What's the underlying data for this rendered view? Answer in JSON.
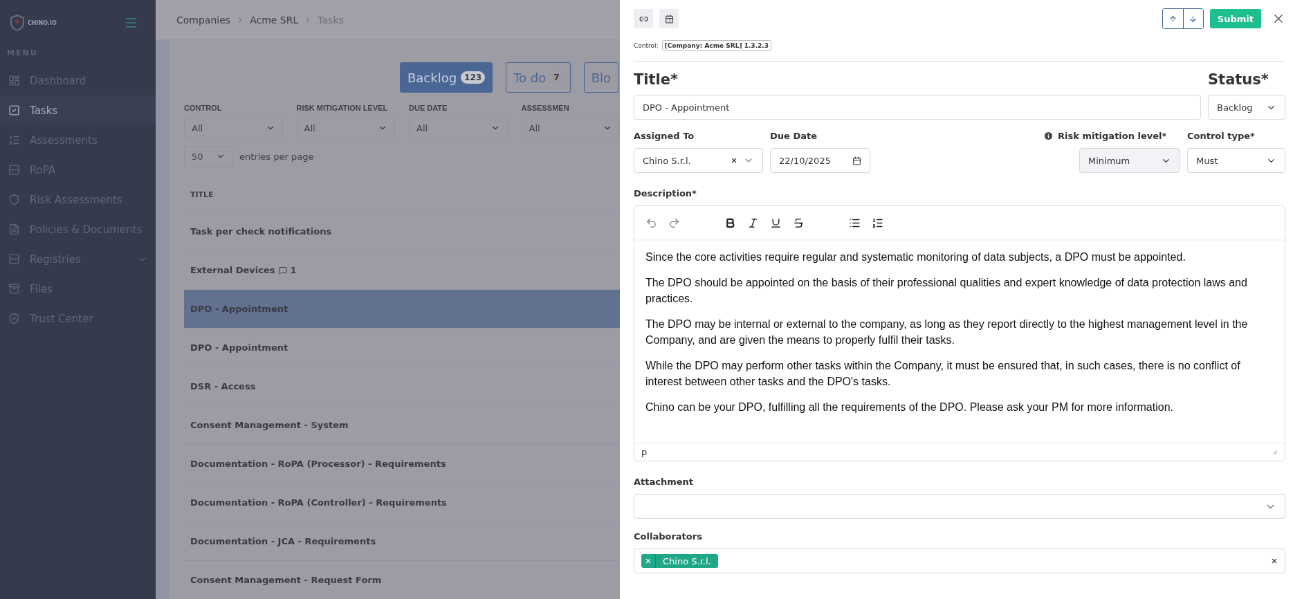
{
  "sidebar": {
    "brand": "CHINO.IO",
    "section": "MENU",
    "items": [
      {
        "label": "Dashboard",
        "kind": "link",
        "selected": false
      },
      {
        "label": "Tasks",
        "kind": "link",
        "selected": true
      },
      {
        "label": "Assessments",
        "kind": "link",
        "selected": false
      },
      {
        "label": "RoPA",
        "kind": "link",
        "selected": false
      },
      {
        "label": "Risk Assessments",
        "kind": "link",
        "selected": false
      },
      {
        "label": "Policies & Documents",
        "kind": "link",
        "selected": false
      },
      {
        "label": "Registries",
        "kind": "group",
        "selected": false
      },
      {
        "label": "Files",
        "kind": "link",
        "selected": false
      },
      {
        "label": "Trust Center",
        "kind": "link",
        "selected": false
      }
    ]
  },
  "breadcrumb": [
    "Companies",
    "Acme SRL",
    "Tasks"
  ],
  "status_tabs": [
    {
      "label": "Backlog",
      "count": "123",
      "selected": true
    },
    {
      "label": "To do",
      "count": "7",
      "selected": false
    },
    {
      "label": "Blo",
      "selected": false
    }
  ],
  "filters": [
    {
      "label": "CONTROL",
      "value": "All"
    },
    {
      "label": "RISK MITIGATION LEVEL",
      "value": "All"
    },
    {
      "label": "DUE DATE",
      "value": "All"
    },
    {
      "label": "ASSESSMEN",
      "value": "All"
    }
  ],
  "page_size": {
    "value": "50",
    "label": "entries per page"
  },
  "table": {
    "column": "TITLE",
    "rows": [
      {
        "title": "Task per check notifications",
        "selected": false
      },
      {
        "title": "External Devices",
        "comments": "1",
        "selected": false
      },
      {
        "title": "DPO - Appointment",
        "selected": true
      },
      {
        "title": "DPO - Appointment",
        "selected": false
      },
      {
        "title": "DSR - Access",
        "selected": false
      },
      {
        "title": "Consent Management - System",
        "selected": false
      },
      {
        "title": "Documentation - RoPA (Processor) - Requirements",
        "selected": false
      },
      {
        "title": "Documentation - RoPA (Controller) - Requirements",
        "selected": false
      },
      {
        "title": "Documentation - JCA - Requirements",
        "selected": false
      },
      {
        "title": "Consent Management - Request Form",
        "selected": false
      }
    ]
  },
  "drawer": {
    "submit": "Submit",
    "control_label": "Control:",
    "control_tag": "[Company: Acme SRL] 1.3.2.3",
    "title_label": "Title*",
    "title_value": "DPO - Appointment",
    "status_label": "Status*",
    "status_value": "Backlog",
    "assigned_label": "Assigned To",
    "assigned_value": "Chino S.r.l.",
    "due_label": "Due Date",
    "due_value": "22/10/2025",
    "risk_label": "Risk mitigation level*",
    "risk_value": "Minimum",
    "risk_disabled": true,
    "control_type_label": "Control type*",
    "control_type_value": "Must",
    "description_label": "Description*",
    "description": [
      "Since the core activities require regular and systematic monitoring of data subjects, a DPO must be appointed.",
      "The DPO should be appointed on the basis of their professional qualities and expert knowledge of data protection laws and practices.",
      "The DPO may be internal or external to the company, as long as they report directly to the highest management level in the Company, and are given the means to properly fulfil their tasks.",
      "While the DPO may perform other tasks within the Company, it must be ensured that, in such cases, there is no conflict of interest between other tasks and the DPO's tasks.",
      "Chino can be your DPO, fulfilling all the requirements of the DPO. Please ask your PM for more information."
    ],
    "editor_path": "p",
    "attachment_label": "Attachment",
    "collaborators_label": "Collaborators",
    "collaborators": [
      "Chino S.r.l."
    ]
  }
}
